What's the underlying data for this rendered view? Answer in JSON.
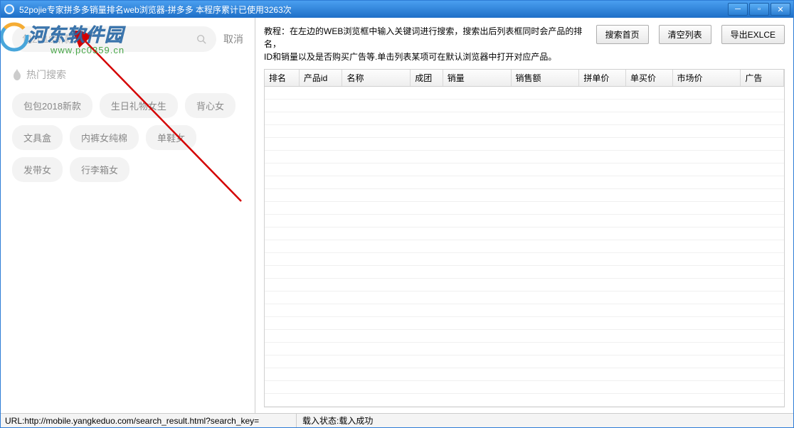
{
  "titlebar": {
    "text": "52pojie专家拼多多销量排名web浏览器-拼多多    本程序累计已使用3263次"
  },
  "search": {
    "placeholder": "包2018新款",
    "cancel": "取消"
  },
  "hotsearch": {
    "title": "热门搜索",
    "tags": [
      "包包2018新款",
      "生日礼物女生",
      "背心女",
      "文具盒",
      "内裤女纯棉",
      "单鞋女",
      "发带女",
      "行李箱女"
    ]
  },
  "instructions": {
    "line1": "教程：在左边的WEB浏览框中输入关键词进行搜索，搜索出后列表框同时会产品的排名，",
    "line2": "ID和销量以及是否购买广告等.单击列表某项可在默认浏览器中打开对应产品。"
  },
  "buttons": {
    "searchHome": "搜索首页",
    "clearList": "清空列表",
    "exportExcel": "导出EXLCE"
  },
  "columns": [
    "排名",
    "产品id",
    "名称",
    "成团",
    "销量",
    "销售额",
    "拼单价",
    "单买价",
    "市场价",
    "广告"
  ],
  "status": {
    "url": "URL:http://mobile.yangkeduo.com/search_result.html?search_key=",
    "load": "载入状态:载入成功"
  },
  "watermark": {
    "cn": "河东软件园",
    "url": "www.pc0359.cn"
  }
}
